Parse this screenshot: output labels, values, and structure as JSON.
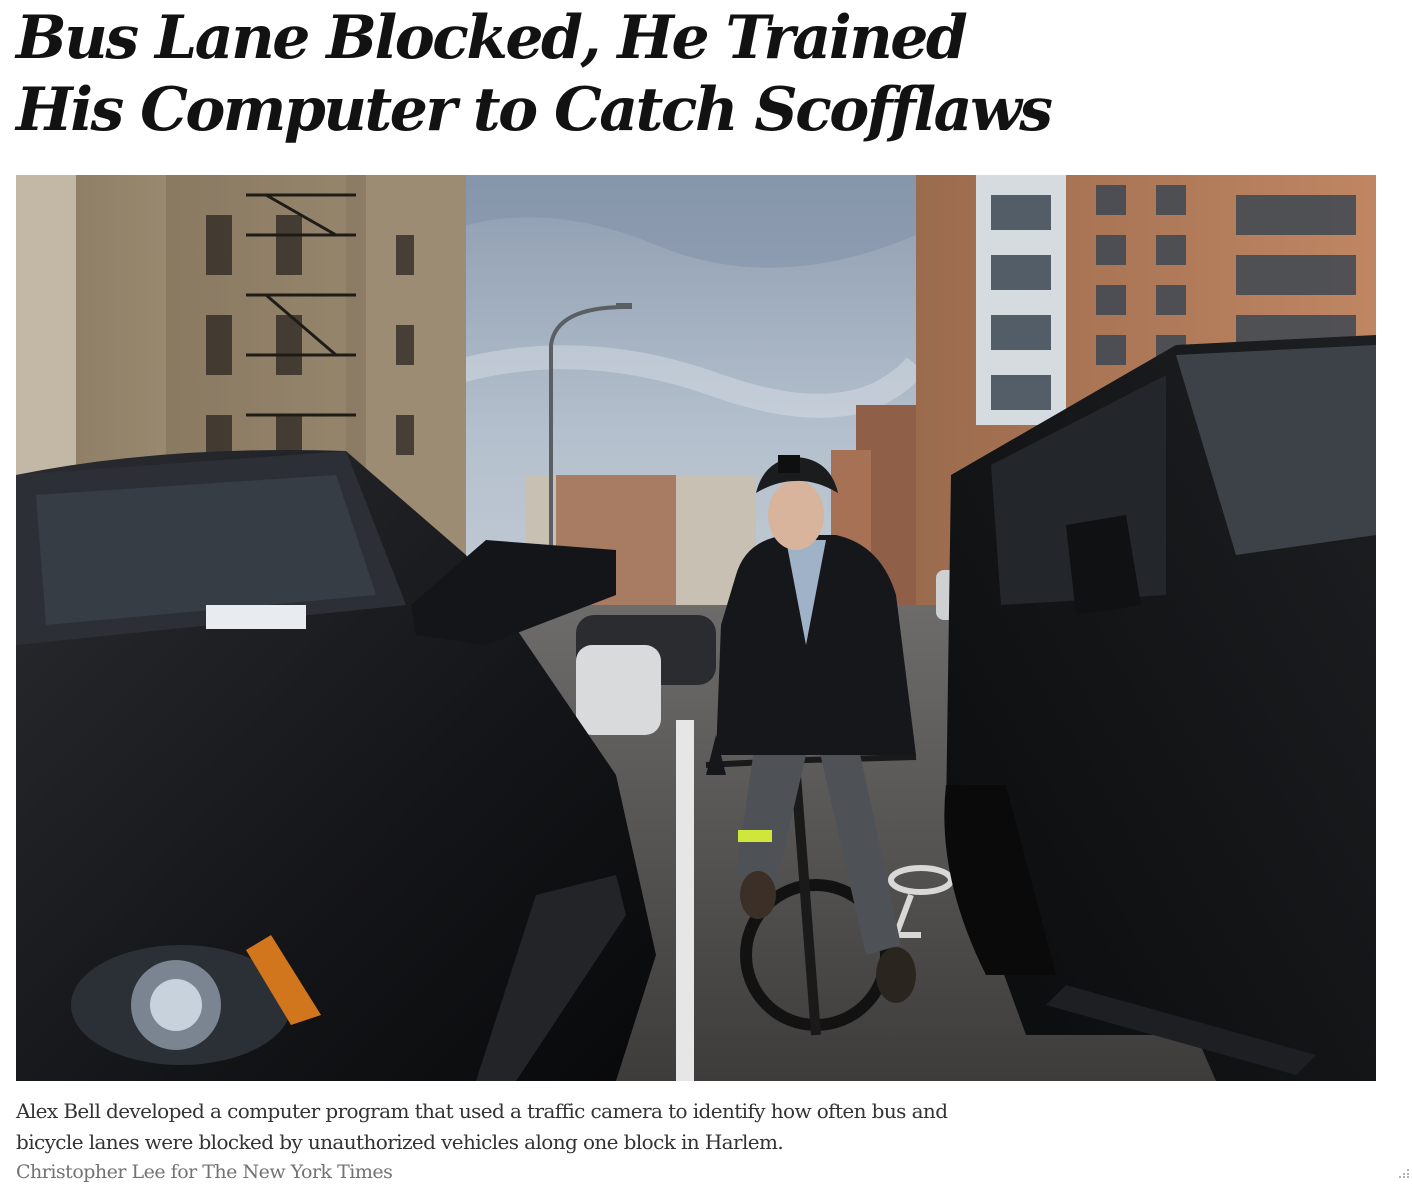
{
  "article": {
    "headline_line1": "Bus Lane Blocked, He Trained",
    "headline_line2": "His Computer to Catch Scofflaws",
    "caption_line1": "Alex Bell developed a computer program that used a traffic camera to identify how often bus and",
    "caption_line2": "bicycle lanes were blocked by unauthorized vehicles along one block in Harlem.",
    "credit": "Christopher Lee for The New York Times"
  },
  "colors": {
    "text": "#121212",
    "caption": "#333333",
    "credit": "#727272",
    "sky": "#a9b7c7",
    "vehicle": "#141518"
  },
  "icons": {
    "corner": "resize-grip-icon"
  }
}
